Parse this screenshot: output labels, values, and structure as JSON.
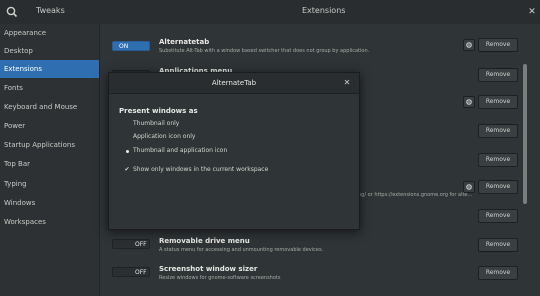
{
  "titlebar": {
    "left_title": "Tweaks",
    "center_title": "Extensions",
    "search_icon": "search-icon",
    "close_icon": "close-icon",
    "close_glyph": "✕"
  },
  "sidebar": {
    "items": [
      {
        "label": "Appearance"
      },
      {
        "label": "Desktop"
      },
      {
        "label": "Extensions",
        "active": true
      },
      {
        "label": "Fonts"
      },
      {
        "label": "Keyboard and Mouse"
      },
      {
        "label": "Power"
      },
      {
        "label": "Startup Applications"
      },
      {
        "label": "Top Bar"
      },
      {
        "label": "Typing"
      },
      {
        "label": "Windows"
      },
      {
        "label": "Workspaces"
      }
    ]
  },
  "extensions": [
    {
      "state": "ON",
      "title": "Alternatetab",
      "desc": "Substitute Alt-Tab with a window based switcher that does not group by application.",
      "has_gear": true,
      "remove": "Remove"
    },
    {
      "state": "",
      "title": "Applications menu",
      "desc": "",
      "has_gear": false,
      "remove": "Remove"
    },
    {
      "state": "",
      "title": "",
      "desc": "",
      "has_gear": true,
      "remove": "Remove"
    },
    {
      "state": "",
      "title": "",
      "desc": "",
      "has_gear": false,
      "remove": "Remove"
    },
    {
      "state": "",
      "title": "",
      "desc": "",
      "has_gear": false,
      "remove": "Remove"
    },
    {
      "state": "",
      "title": "",
      "desc": "ng/ or https://extensions.gnome.org for alte...",
      "has_gear": true,
      "remove": "Remove"
    },
    {
      "state": "",
      "title": "",
      "desc": "",
      "has_gear": false,
      "remove": "Remove"
    },
    {
      "state": "OFF",
      "title": "Removable drive menu",
      "desc": "A status menu for accessing and unmounting removable devices.",
      "has_gear": false,
      "remove": "Remove"
    },
    {
      "state": "OFF",
      "title": "Screenshot window sizer",
      "desc": "Resize windows for gnome-software screenshots",
      "has_gear": false,
      "remove": "Remove"
    }
  ],
  "dialog": {
    "title": "AlternateTab",
    "close_glyph": "✕",
    "section": "Present windows as",
    "options": [
      {
        "label": "Thumbnail only",
        "selected": false
      },
      {
        "label": "Application icon only",
        "selected": false
      },
      {
        "label": "Thumbnail and application icon",
        "selected": true
      }
    ],
    "checkbox": {
      "label": "Show only windows in the current workspace",
      "checked": true,
      "glyph": "✔"
    }
  },
  "colors": {
    "accent": "#2f6fb1",
    "background": "#2f3436",
    "sidebar": "#2d3133"
  }
}
